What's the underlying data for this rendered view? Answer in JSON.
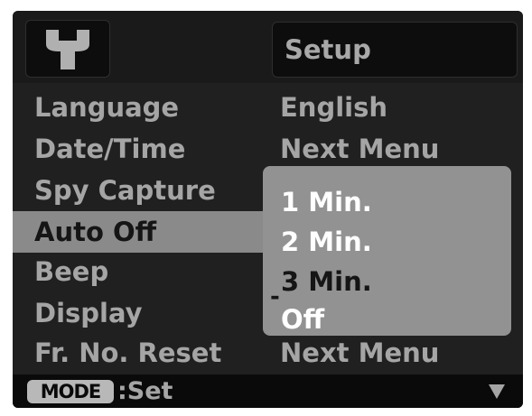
{
  "header": {
    "icon": "wrench-icon",
    "title": "Setup"
  },
  "menu": {
    "rows": [
      {
        "label": "Language",
        "value": "English"
      },
      {
        "label": "Date/Time",
        "value": "Next Menu"
      },
      {
        "label": "Spy Capture",
        "value": ""
      },
      {
        "label": "Auto Off",
        "value": "",
        "selected": true
      },
      {
        "label": "Beep",
        "value": ""
      },
      {
        "label": "Display",
        "value": ""
      },
      {
        "label": "Fr. No. Reset",
        "value": "Next Menu"
      }
    ]
  },
  "popup": {
    "options": [
      "1 Min.",
      "2 Min.",
      "3 Min.",
      "Off"
    ],
    "current_marker": "-",
    "current_option": "3 Min."
  },
  "footer": {
    "mode_button": "MODE",
    "action_label": ":Set",
    "scroll_icon": "down-arrow-icon"
  },
  "colors": {
    "screen_background": "#202020",
    "text": "#a5a5a5",
    "highlight": "#8a8a8a",
    "popup": "#929292"
  }
}
